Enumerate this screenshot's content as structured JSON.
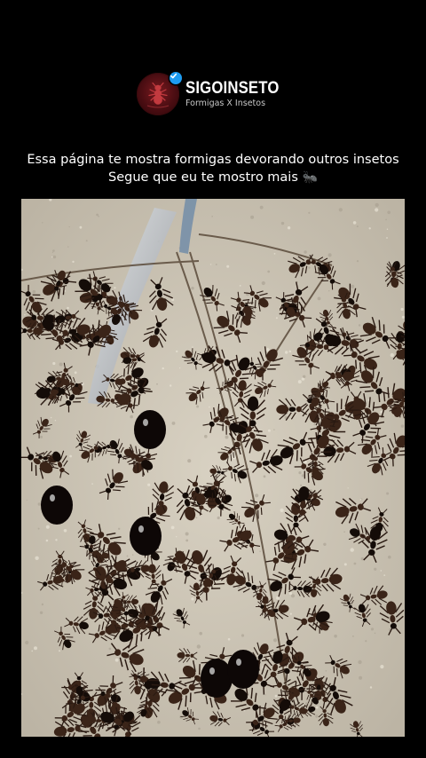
{
  "profile": {
    "name": "SIGOINSETO",
    "subtitle": "Formigas X Insetos",
    "verified": true,
    "avatar_icon": "ant-logo-icon",
    "accent_color": "#1d9bf0"
  },
  "caption": {
    "line1": "Essa página te mostra formigas devorando outros insetos",
    "line2": "Segue que eu te mostro mais",
    "emoji": "🐜"
  },
  "media": {
    "icon": "ant-swarm-photo"
  },
  "colors": {
    "background": "#000000",
    "text": "#ffffff"
  }
}
